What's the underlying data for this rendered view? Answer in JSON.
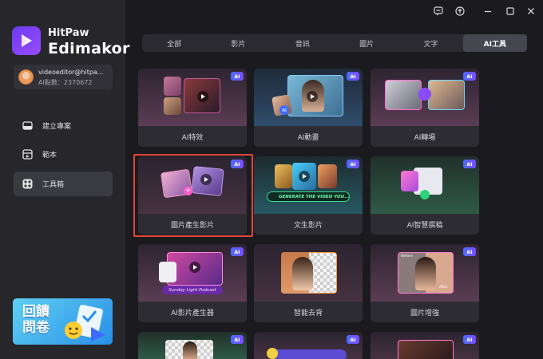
{
  "window": {
    "controls": [
      "feedback-icon",
      "upload-icon",
      "minimize-icon",
      "maximize-icon",
      "close-icon"
    ]
  },
  "brand": {
    "top": "HitPaw",
    "main": "Edimakor"
  },
  "account": {
    "email": "videoeditor@hitpa...",
    "points": "AI點數：2370672"
  },
  "nav": [
    {
      "label": "建立專案",
      "icon": "new-project-icon",
      "active": false
    },
    {
      "label": "範本",
      "icon": "template-icon",
      "active": false
    },
    {
      "label": "工具箱",
      "icon": "toolbox-icon",
      "active": true
    }
  ],
  "promo": {
    "text": "回饋問卷"
  },
  "tabs": [
    {
      "label": "全部",
      "active": false
    },
    {
      "label": "影片",
      "active": false
    },
    {
      "label": "音訊",
      "active": false
    },
    {
      "label": "圖片",
      "active": false
    },
    {
      "label": "文字",
      "active": false
    },
    {
      "label": "AI工具",
      "active": true
    }
  ],
  "badge": "AI",
  "cards": [
    {
      "label": "AI特效"
    },
    {
      "label": "AI動畫"
    },
    {
      "label": "AI轉場"
    },
    {
      "label": "圖片產生影片",
      "selected": true
    },
    {
      "label": "文生影片",
      "thumb_text": "GENERATE THE VIDEO YOU..."
    },
    {
      "label": "AI智慧撰稿"
    },
    {
      "label": "AI影片產生器",
      "thumb_text": "Sunday Light Podcast"
    },
    {
      "label": "智能去背"
    },
    {
      "label": "圖片增強",
      "thumb_text_a": "Before",
      "thumb_text_b": "After"
    }
  ]
}
